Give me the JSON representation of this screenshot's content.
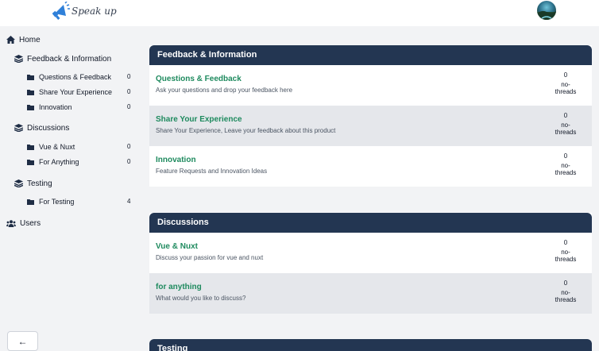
{
  "app": {
    "logo_text": "Speak up"
  },
  "sidebar": {
    "home": "Home",
    "groups": [
      {
        "label": "Feedback & Information",
        "items": [
          {
            "label": "Questions & Feedback",
            "count": "0"
          },
          {
            "label": "Share Your Experience",
            "count": "0"
          },
          {
            "label": "Innovation",
            "count": "0"
          }
        ]
      },
      {
        "label": "Discussions",
        "items": [
          {
            "label": "Vue & Nuxt",
            "count": "0"
          },
          {
            "label": "For Anything",
            "count": "0"
          }
        ]
      },
      {
        "label": "Testing",
        "items": [
          {
            "label": "For Testing",
            "count": "4"
          }
        ]
      }
    ],
    "users": "Users",
    "back_icon": "←"
  },
  "main": {
    "sections": [
      {
        "title": "Feedback & Information",
        "forums": [
          {
            "title": "Questions & Feedback",
            "desc": "Ask your questions and drop your feedback here",
            "count": "0",
            "count_label": "no-threads"
          },
          {
            "title": "Share Your Experience",
            "desc": "Share Your Experience, Leave your feedback about this product",
            "count": "0",
            "count_label": "no-threads"
          },
          {
            "title": "Innovation",
            "desc": "Feature Requests and Innovation Ideas",
            "count": "0",
            "count_label": "no-threads"
          }
        ]
      },
      {
        "title": "Discussions",
        "forums": [
          {
            "title": "Vue & Nuxt",
            "desc": "Discuss your passion for vue and nuxt",
            "count": "0",
            "count_label": "no-threads"
          },
          {
            "title": "for anything",
            "desc": "What would you like to discuss?",
            "count": "0",
            "count_label": "no-threads"
          }
        ]
      },
      {
        "title": "Testing",
        "forums": []
      }
    ]
  },
  "colors": {
    "header_bar": "#233652",
    "forum_title": "#1e8a5e",
    "row_alt": "#e5e7eb",
    "page_bg": "#f2f3f5"
  }
}
